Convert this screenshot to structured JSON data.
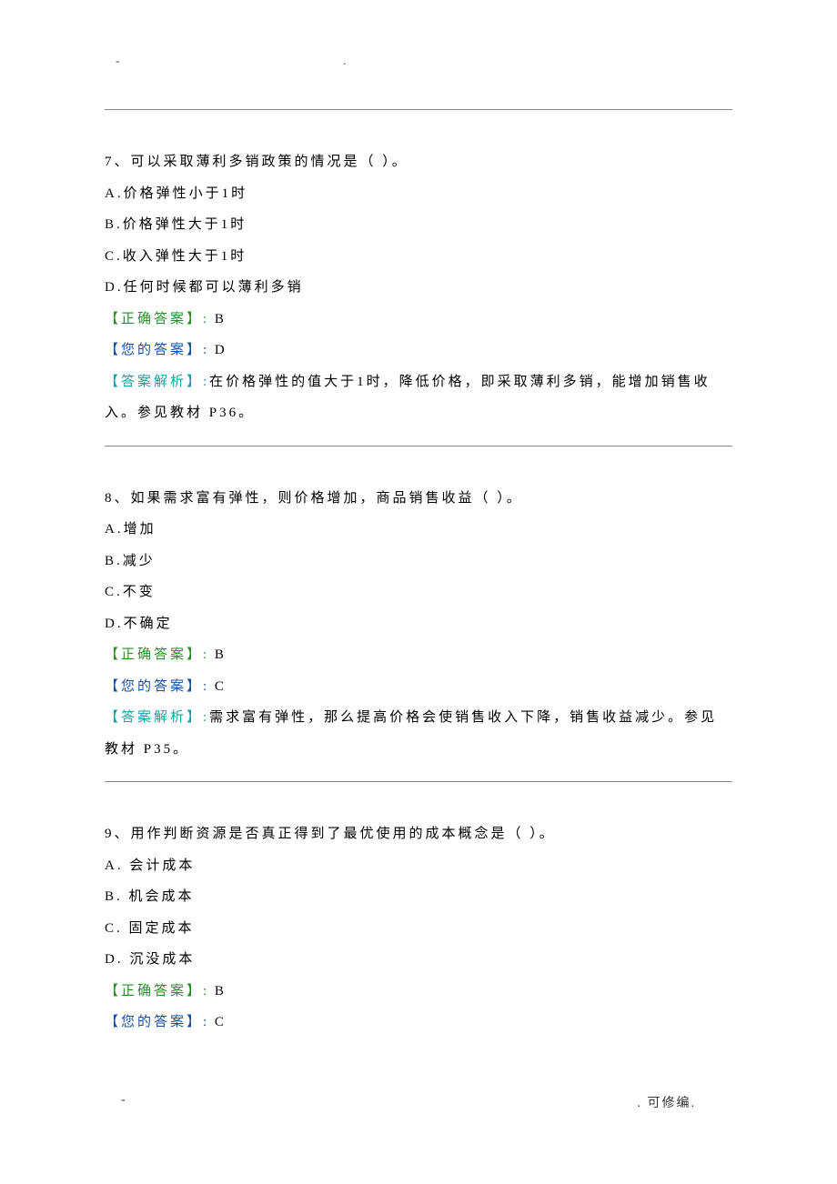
{
  "marks": {
    "top_dash": "-",
    "top_dot": "."
  },
  "questions": [
    {
      "number": "7、",
      "stem": "可以采取薄利多销政策的情况是（ ）。",
      "options": {
        "A": "A.价格弹性小于1时",
        "B": "B.价格弹性大于1时",
        "C": "C.收入弹性大于1时",
        "D": "D.任何时候都可以薄利多销"
      },
      "correct_label": "【正确答案】:",
      "correct_value": " B",
      "your_label": "【您的答案】:",
      "your_value": " D",
      "analysis_label": "【答案解析】:",
      "analysis_text": "在价格弹性的值大于1时，降低价格，即采取薄利多销，能增加销售收入。参见教材 P36。"
    },
    {
      "number": "8、",
      "stem": "如果需求富有弹性，则价格增加，商品销售收益（ ）。",
      "options": {
        "A": "A.增加",
        "B": "B.减少",
        "C": "C.不变",
        "D": "D.不确定"
      },
      "correct_label": "【正确答案】:",
      "correct_value": " B",
      "your_label": "【您的答案】:",
      "your_value": " C",
      "analysis_label": "【答案解析】:",
      "analysis_text": "需求富有弹性，那么提高价格会使销售收入下降，销售收益减少。参见教材 P35。"
    },
    {
      "number": "9、",
      "stem": "用作判断资源是否真正得到了最优使用的成本概念是（ ）。",
      "options": {
        "A": "A.  会计成本",
        "B": "B.  机会成本",
        "C": "C.  固定成本",
        "D": "D.  沉没成本"
      },
      "correct_label": "【正确答案】:",
      "correct_value": " B",
      "your_label": "【您的答案】:",
      "your_value": " C",
      "analysis_label": "",
      "analysis_text": ""
    }
  ],
  "footer": {
    "dash": "-",
    "right": ". 可修编."
  }
}
